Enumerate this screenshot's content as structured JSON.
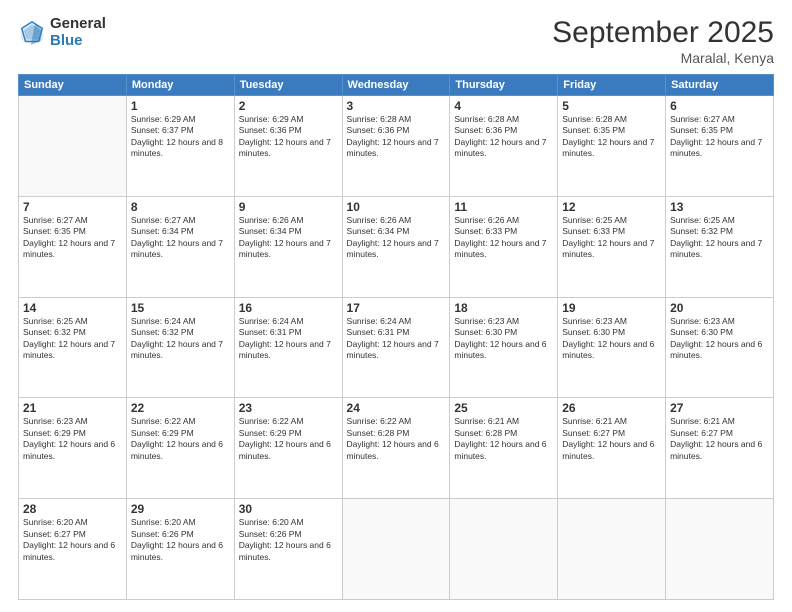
{
  "logo": {
    "general": "General",
    "blue": "Blue"
  },
  "header": {
    "month": "September 2025",
    "location": "Maralal, Kenya"
  },
  "weekdays": [
    "Sunday",
    "Monday",
    "Tuesday",
    "Wednesday",
    "Thursday",
    "Friday",
    "Saturday"
  ],
  "weeks": [
    [
      {
        "day": "",
        "empty": true
      },
      {
        "day": "1",
        "sunrise": "6:29 AM",
        "sunset": "6:37 PM",
        "daylight": "12 hours and 8 minutes."
      },
      {
        "day": "2",
        "sunrise": "6:29 AM",
        "sunset": "6:36 PM",
        "daylight": "12 hours and 7 minutes."
      },
      {
        "day": "3",
        "sunrise": "6:28 AM",
        "sunset": "6:36 PM",
        "daylight": "12 hours and 7 minutes."
      },
      {
        "day": "4",
        "sunrise": "6:28 AM",
        "sunset": "6:36 PM",
        "daylight": "12 hours and 7 minutes."
      },
      {
        "day": "5",
        "sunrise": "6:28 AM",
        "sunset": "6:35 PM",
        "daylight": "12 hours and 7 minutes."
      },
      {
        "day": "6",
        "sunrise": "6:27 AM",
        "sunset": "6:35 PM",
        "daylight": "12 hours and 7 minutes."
      }
    ],
    [
      {
        "day": "7",
        "sunrise": "6:27 AM",
        "sunset": "6:35 PM",
        "daylight": "12 hours and 7 minutes."
      },
      {
        "day": "8",
        "sunrise": "6:27 AM",
        "sunset": "6:34 PM",
        "daylight": "12 hours and 7 minutes."
      },
      {
        "day": "9",
        "sunrise": "6:26 AM",
        "sunset": "6:34 PM",
        "daylight": "12 hours and 7 minutes."
      },
      {
        "day": "10",
        "sunrise": "6:26 AM",
        "sunset": "6:34 PM",
        "daylight": "12 hours and 7 minutes."
      },
      {
        "day": "11",
        "sunrise": "6:26 AM",
        "sunset": "6:33 PM",
        "daylight": "12 hours and 7 minutes."
      },
      {
        "day": "12",
        "sunrise": "6:25 AM",
        "sunset": "6:33 PM",
        "daylight": "12 hours and 7 minutes."
      },
      {
        "day": "13",
        "sunrise": "6:25 AM",
        "sunset": "6:32 PM",
        "daylight": "12 hours and 7 minutes."
      }
    ],
    [
      {
        "day": "14",
        "sunrise": "6:25 AM",
        "sunset": "6:32 PM",
        "daylight": "12 hours and 7 minutes."
      },
      {
        "day": "15",
        "sunrise": "6:24 AM",
        "sunset": "6:32 PM",
        "daylight": "12 hours and 7 minutes."
      },
      {
        "day": "16",
        "sunrise": "6:24 AM",
        "sunset": "6:31 PM",
        "daylight": "12 hours and 7 minutes."
      },
      {
        "day": "17",
        "sunrise": "6:24 AM",
        "sunset": "6:31 PM",
        "daylight": "12 hours and 7 minutes."
      },
      {
        "day": "18",
        "sunrise": "6:23 AM",
        "sunset": "6:30 PM",
        "daylight": "12 hours and 6 minutes."
      },
      {
        "day": "19",
        "sunrise": "6:23 AM",
        "sunset": "6:30 PM",
        "daylight": "12 hours and 6 minutes."
      },
      {
        "day": "20",
        "sunrise": "6:23 AM",
        "sunset": "6:30 PM",
        "daylight": "12 hours and 6 minutes."
      }
    ],
    [
      {
        "day": "21",
        "sunrise": "6:23 AM",
        "sunset": "6:29 PM",
        "daylight": "12 hours and 6 minutes."
      },
      {
        "day": "22",
        "sunrise": "6:22 AM",
        "sunset": "6:29 PM",
        "daylight": "12 hours and 6 minutes."
      },
      {
        "day": "23",
        "sunrise": "6:22 AM",
        "sunset": "6:29 PM",
        "daylight": "12 hours and 6 minutes."
      },
      {
        "day": "24",
        "sunrise": "6:22 AM",
        "sunset": "6:28 PM",
        "daylight": "12 hours and 6 minutes."
      },
      {
        "day": "25",
        "sunrise": "6:21 AM",
        "sunset": "6:28 PM",
        "daylight": "12 hours and 6 minutes."
      },
      {
        "day": "26",
        "sunrise": "6:21 AM",
        "sunset": "6:27 PM",
        "daylight": "12 hours and 6 minutes."
      },
      {
        "day": "27",
        "sunrise": "6:21 AM",
        "sunset": "6:27 PM",
        "daylight": "12 hours and 6 minutes."
      }
    ],
    [
      {
        "day": "28",
        "sunrise": "6:20 AM",
        "sunset": "6:27 PM",
        "daylight": "12 hours and 6 minutes."
      },
      {
        "day": "29",
        "sunrise": "6:20 AM",
        "sunset": "6:26 PM",
        "daylight": "12 hours and 6 minutes."
      },
      {
        "day": "30",
        "sunrise": "6:20 AM",
        "sunset": "6:26 PM",
        "daylight": "12 hours and 6 minutes."
      },
      {
        "day": "",
        "empty": true
      },
      {
        "day": "",
        "empty": true
      },
      {
        "day": "",
        "empty": true
      },
      {
        "day": "",
        "empty": true
      }
    ]
  ]
}
